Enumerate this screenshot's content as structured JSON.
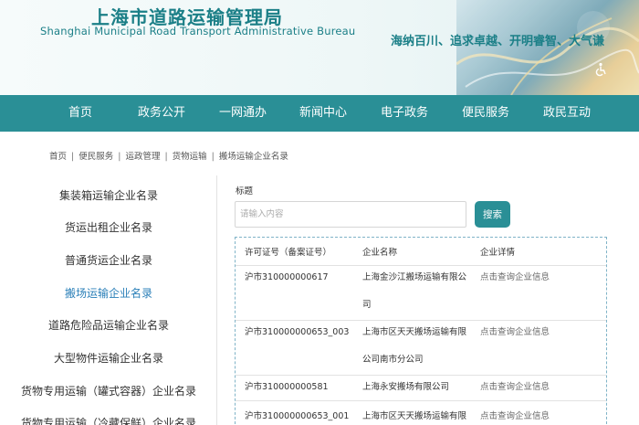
{
  "header": {
    "title_cn": "上海市道路运输管理局",
    "title_en": "Shanghai Municipal Road Transport Administrative Bureau",
    "slogan": "海纳百川、追求卓越、开明睿智、大气谦"
  },
  "nav": [
    "首页",
    "政务公开",
    "一网通办",
    "新闻中心",
    "电子政务",
    "便民服务",
    "政民互动"
  ],
  "breadcrumb": [
    "首页",
    "便民服务",
    "运政管理",
    "货物运输",
    "搬场运输企业名录"
  ],
  "sidebar": {
    "items": [
      "集装箱运输企业名录",
      "货运出租企业名录",
      "普通货运企业名录",
      "搬场运输企业名录",
      "道路危险品运输企业名录",
      "大型物件运输企业名录",
      "货物专用运输（罐式容器）企业名录",
      "货物专用运输（冷藏保鲜）企业名录"
    ],
    "active_index": 3
  },
  "search": {
    "title": "标题",
    "placeholder": "请输入内容",
    "button": "搜索"
  },
  "table": {
    "headers": [
      "许可证号（备案证号）",
      "企业名称",
      "企业详情"
    ],
    "rows": [
      {
        "license": "沪市310000000617",
        "name_line1": "上海金沙江搬场运输有限公",
        "name_line2": "司",
        "detail": "点击查询企业信息"
      },
      {
        "license": "沪市310000000653_003",
        "name_line1": "上海市区天天搬场运输有限",
        "name_line2": "公司南市分公司",
        "detail": "点击查询企业信息"
      },
      {
        "license": "沪市310000000581",
        "name_line1": "上海永安搬场有限公司",
        "name_line2": "",
        "detail": "点击查询企业信息"
      },
      {
        "license": "沪市310000000653_001",
        "name_line1": "上海市区天天搬场运输有限",
        "name_line2": "",
        "detail": "点击查询企业信息"
      }
    ]
  },
  "colors": {
    "primary": "#2a8f96",
    "brand_text": "#1b7f87",
    "active_link": "#2a7fb8"
  }
}
